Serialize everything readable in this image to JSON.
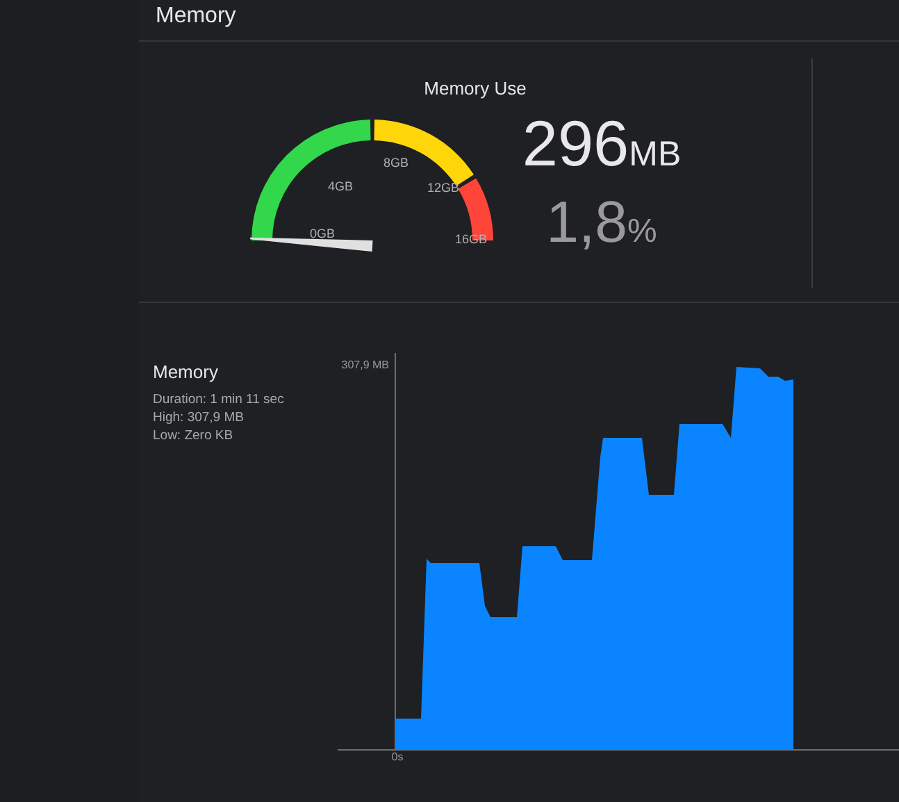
{
  "header": {
    "title": "Memory"
  },
  "gauge": {
    "title": "Memory Use",
    "ticks": [
      "0GB",
      "4GB",
      "8GB",
      "12GB",
      "16GB"
    ],
    "level": 0.02,
    "value": "296",
    "value_unit": "MB",
    "percent": "1,8",
    "percent_unit": "%"
  },
  "graph": {
    "title": "Memory",
    "details": [
      "Duration: 1 min 11 sec",
      "High: 307,9 MB",
      "Low: Zero KB"
    ],
    "y_max_label": "307,9 MB",
    "x_start_label": "0s"
  }
}
